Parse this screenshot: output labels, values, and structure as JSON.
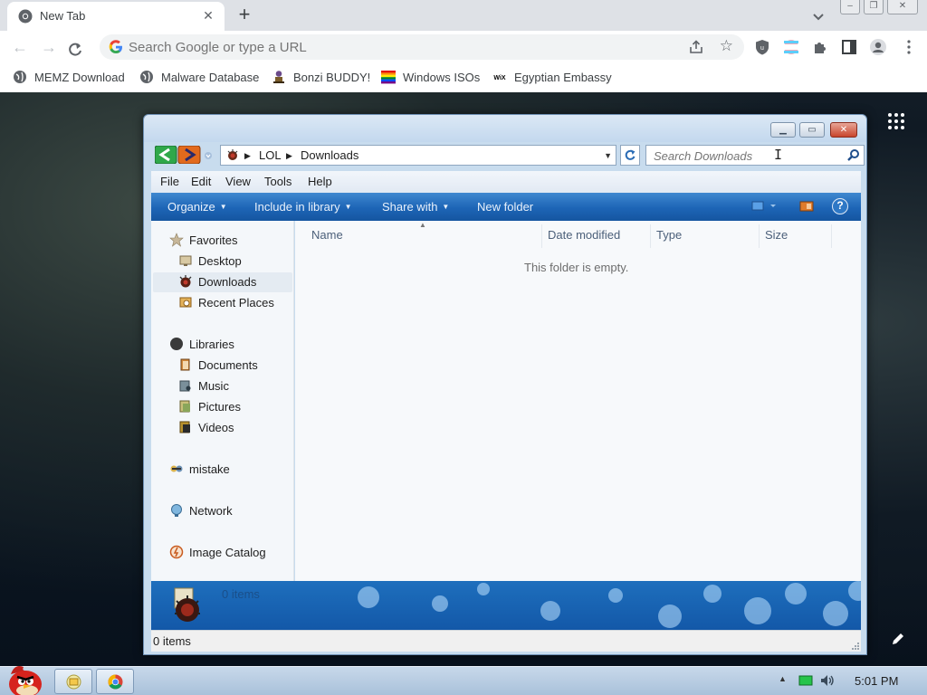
{
  "browser": {
    "tab_title": "New Tab",
    "omnibox_placeholder": "Search Google or type a URL",
    "bookmarks": [
      {
        "label": "MEMZ Download",
        "icon": "globe-icon"
      },
      {
        "label": "Malware Database",
        "icon": "globe-icon"
      },
      {
        "label": "Bonzi BUDDY!",
        "icon": "bonzi-icon"
      },
      {
        "label": "Windows ISOs",
        "icon": "rainbow-flag-icon"
      },
      {
        "label": "Egyptian Embassy",
        "icon": "wix-icon"
      }
    ],
    "wix_glyph": "WiX",
    "close_glyph": "✕",
    "new_tab_glyph": "+",
    "help_glyph": "?",
    "colors": {
      "tabstrip": "#dee1e6",
      "accent": "#1a73e8"
    }
  },
  "explorer": {
    "breadcrumbs": [
      "LOL",
      "Downloads"
    ],
    "search_placeholder": "Search Downloads",
    "menu": [
      "File",
      "Edit",
      "View",
      "Tools",
      "Help"
    ],
    "commands": {
      "organize": "Organize",
      "include_in_library": "Include in library",
      "share_with": "Share with",
      "new_folder": "New folder"
    },
    "nav": {
      "favorites": "Favorites",
      "favorites_items": [
        "Desktop",
        "Downloads",
        "Recent Places"
      ],
      "libraries": "Libraries",
      "libraries_items": [
        "Documents",
        "Music",
        "Pictures",
        "Videos"
      ],
      "homegroup": "mistake",
      "network": "Network",
      "image_catalog": "Image Catalog",
      "selected": "Downloads"
    },
    "columns": [
      "Name",
      "Date modified",
      "Type",
      "Size"
    ],
    "empty_message": "This folder is empty.",
    "details_text": "0 items",
    "status_text": "0 items",
    "colors": {
      "command_bar": "#1d65b6",
      "details_pane": "#1358a8"
    }
  },
  "taskbar": {
    "clock": "5:01 PM",
    "icons": [
      "angry-bird-start-orb",
      "explorer-folder-icon",
      "chrome-icon"
    ]
  }
}
